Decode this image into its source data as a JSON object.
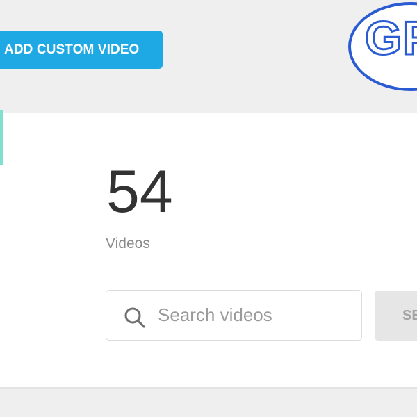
{
  "header": {
    "add_button_label": "ADD CUSTOM VIDEO",
    "logo_text": "GP",
    "accent_color": "#1ea8e4",
    "logo_color": "#2a5bd3"
  },
  "stats": {
    "count": "54",
    "count_label": "Videos"
  },
  "search": {
    "placeholder": "Search videos",
    "value": "",
    "button_label": "SE"
  },
  "icons": {
    "search": "search-icon"
  }
}
